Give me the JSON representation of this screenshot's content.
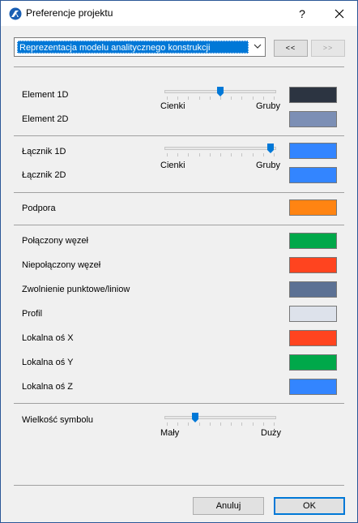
{
  "window": {
    "title": "Preferencje projektu",
    "help": "?"
  },
  "combo": {
    "value": "Reprezentacja modelu analitycznego konstrukcji"
  },
  "nav": {
    "prev": "<<",
    "next": ">>"
  },
  "section_elements": {
    "label_1d": "Element 1D",
    "label_2d": "Element 2D",
    "slider_min": "Cienki",
    "slider_max": "Gruby",
    "slider_value": 0.5,
    "color_1d": "#2c3441",
    "color_2d": "#7c8fb5"
  },
  "section_links": {
    "label_1d": "Łącznik 1D",
    "label_2d": "Łącznik 2D",
    "slider_min": "Cienki",
    "slider_max": "Gruby",
    "slider_value": 1.0,
    "color_1d": "#3385ff",
    "color_2d": "#3385ff"
  },
  "section_support": {
    "label": "Podpora",
    "color": "#ff8412"
  },
  "section_nodes": {
    "items": [
      {
        "label": "Połączony węzeł",
        "color": "#00a84a"
      },
      {
        "label": "Niepołączony węzeł",
        "color": "#ff441f"
      },
      {
        "label": "Zwolnienie punktowe/liniow",
        "color": "#5c7194"
      },
      {
        "label": "Profil",
        "color": "#dde2eb"
      },
      {
        "label": "Lokalna oś X",
        "color": "#ff441f"
      },
      {
        "label": "Lokalna oś Y",
        "color": "#00a84a"
      },
      {
        "label": "Lokalna oś Z",
        "color": "#3385ff"
      }
    ]
  },
  "section_symbol": {
    "label": "Wielkość symbolu",
    "slider_min": "Mały",
    "slider_max": "Duży",
    "slider_value": 0.25
  },
  "buttons": {
    "cancel": "Anuluj",
    "ok": "OK"
  }
}
